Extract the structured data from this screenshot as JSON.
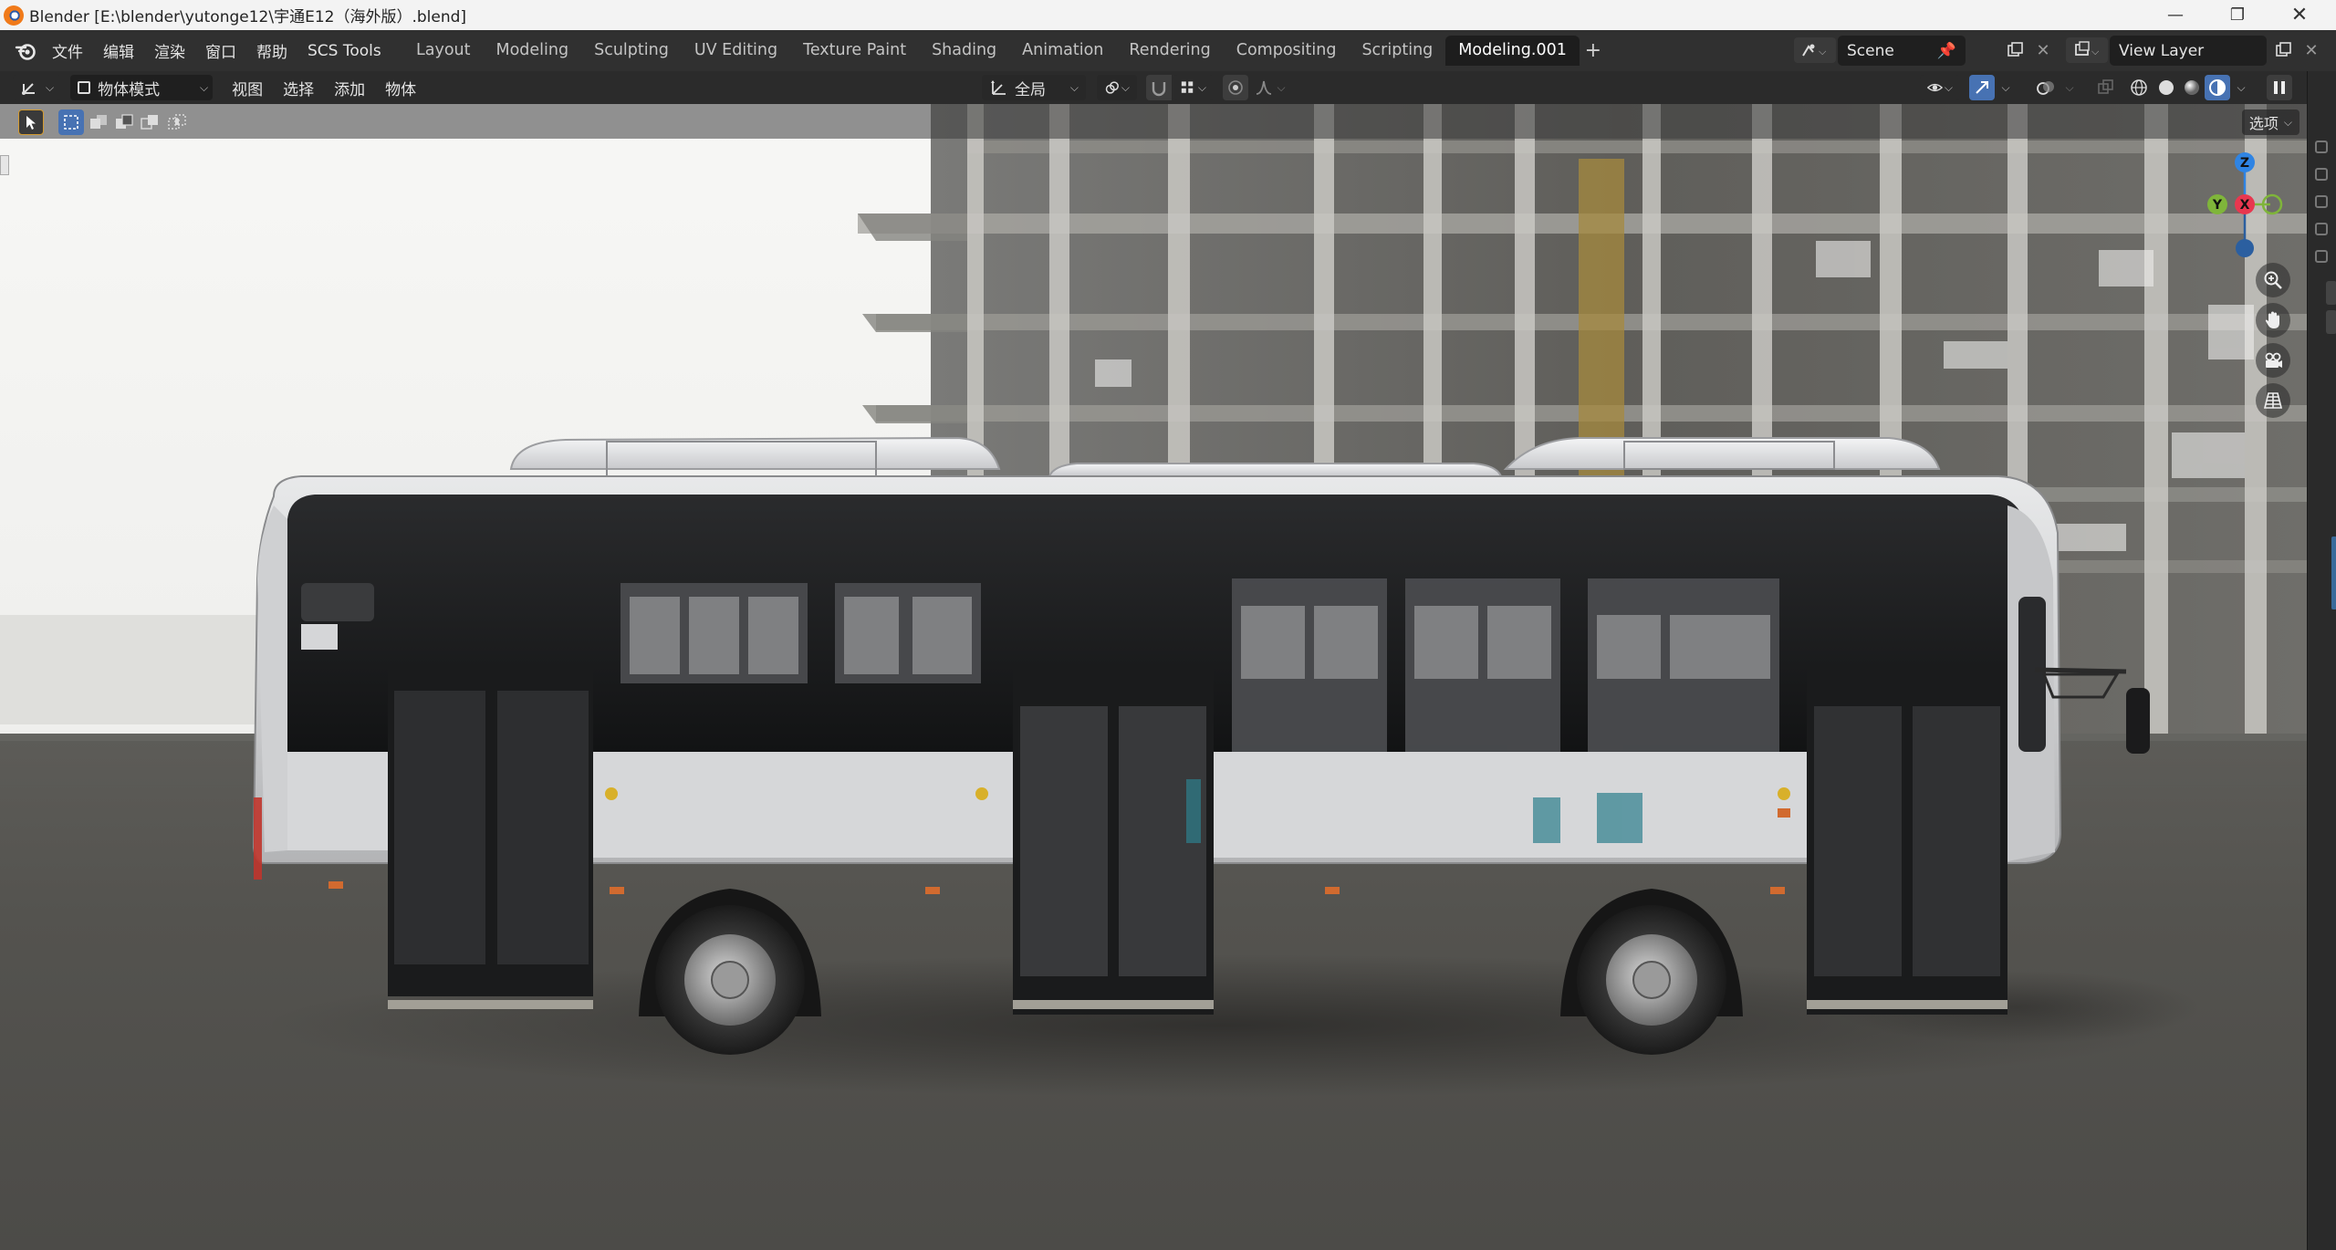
{
  "window": {
    "title": "Blender [E:\\blender\\yutonge12\\宇通E12（海外版）.blend]"
  },
  "menu": {
    "items": [
      "文件",
      "编辑",
      "渲染",
      "窗口",
      "帮助",
      "SCS Tools"
    ]
  },
  "workspace_tabs": [
    "Layout",
    "Modeling",
    "Sculpting",
    "UV Editing",
    "Texture Paint",
    "Shading",
    "Animation",
    "Rendering",
    "Compositing",
    "Scripting",
    "Modeling.001"
  ],
  "active_tab": "Modeling.001",
  "scene": {
    "name": "Scene"
  },
  "view_layer": {
    "name": "View Layer"
  },
  "viewport_header": {
    "mode": "物体模式",
    "menus": [
      "视图",
      "选择",
      "添加",
      "物体"
    ],
    "transform_orientation": "全局"
  },
  "viewport": {
    "options_label": "选项",
    "gizmo_axes": {
      "z": "Z",
      "y": "Y",
      "x": "X"
    }
  },
  "colors": {
    "accent_blue": "#4772b3",
    "axis_x": "#e8374f",
    "axis_y": "#7fb53a",
    "axis_z": "#2f84e3"
  },
  "icons": [
    "blender-logo-icon",
    "editor-type-icon",
    "object-mode-icon",
    "transform-orientation-icon",
    "pivot-icon",
    "snap-icon",
    "proportional-edit-icon",
    "visibility-icon",
    "gizmo-icon",
    "overlay-icon",
    "xray-icon",
    "wireframe-shading-icon",
    "solid-shading-icon",
    "material-shading-icon",
    "rendered-shading-icon",
    "zoom-icon",
    "pan-hand-icon",
    "camera-icon",
    "perspective-grid-icon"
  ]
}
